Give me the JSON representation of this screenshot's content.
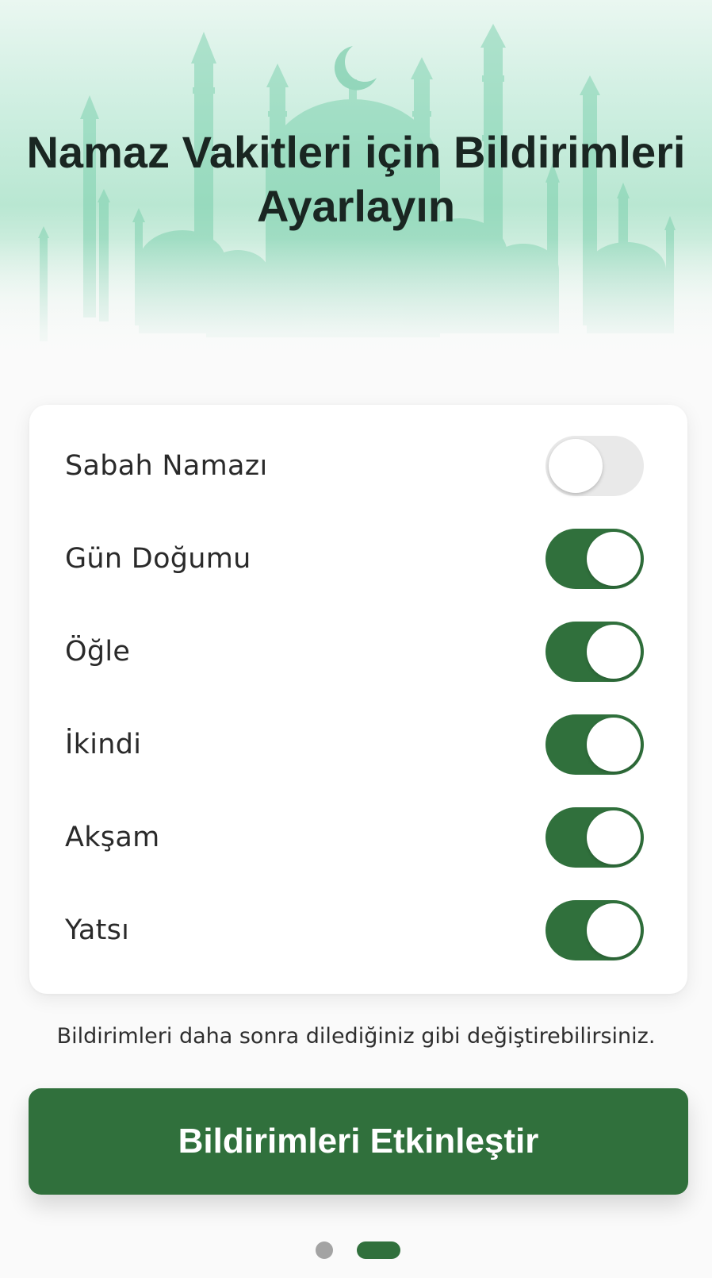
{
  "header": {
    "title": "Namaz Vakitleri için Bildirimleri Ayarlayın"
  },
  "prayers": [
    {
      "label": "Sabah Namazı",
      "enabled": false
    },
    {
      "label": "Gün Doğumu",
      "enabled": true
    },
    {
      "label": "Öğle",
      "enabled": true
    },
    {
      "label": "İkindi",
      "enabled": true
    },
    {
      "label": "Akşam",
      "enabled": true
    },
    {
      "label": "Yatsı",
      "enabled": true
    }
  ],
  "note": "Bildirimleri daha sonra dilediğiniz gibi değiştirebilirsiniz.",
  "cta": {
    "label": "Bildirimleri Etkinleştir"
  },
  "pager": {
    "current_page": 2,
    "total_pages": 2
  },
  "colors": {
    "accent": "#30703c",
    "toggle_off": "#e9e9e9",
    "hero_tint": "#b9e7d2",
    "mosque_silhouette": "#6fcca6"
  },
  "icons": {
    "hero": "mosque-skyline-illustration"
  }
}
